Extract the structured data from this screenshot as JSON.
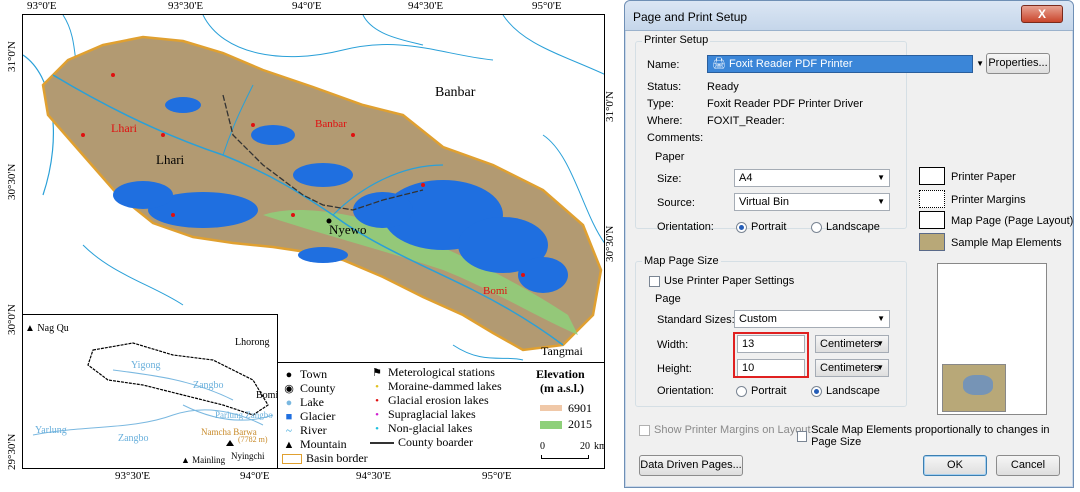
{
  "map": {
    "top_ticks": [
      "93°0'E",
      "93°30'E",
      "94°0'E",
      "94°30'E",
      "95°0'E"
    ],
    "bottom_ticks": [
      "93°30'E",
      "94°0'E",
      "94°30'E",
      "95°0'E"
    ],
    "left_ticks": [
      "31°0'N",
      "30°30'N",
      "30°0'N",
      "29°30'N"
    ],
    "right_ticks": [
      "31°0'N",
      "30°30'N"
    ],
    "labels": {
      "banbar_black": "Banbar",
      "lhari_red": "Lhari",
      "banbar_red": "Banbar",
      "lhari_black": "Lhari",
      "nyewo": "Nyewo",
      "bomi_red": "Bomi",
      "tangmai": "Tangmai"
    },
    "inset": {
      "nag_qu": "Nag Qu",
      "lhorong": "Lhorong",
      "yigong": "Yigong",
      "zangbo_1": "Zangbo",
      "bomi": "Bomi",
      "parlung_zangbo": "Parlung Zangbo",
      "yarlung": "Yarlung",
      "zangbo_2": "Zangbo",
      "namcha_barwa": "Namcha Barwa",
      "peak_height": "(7782 m)",
      "nyingchi": "Nyingchi",
      "mainling": "Mainling"
    },
    "legend": {
      "town": "Town",
      "county": "County",
      "lake": "Lake",
      "glacier": "Glacier",
      "river": "River",
      "mountain": "Mountain",
      "basin_border": "Basin border",
      "met_stations": "Meterological stations",
      "moraine_lakes": "Moraine-dammed lakes",
      "glacial_erosion": "Glacial erosion lakes",
      "supraglacial": "Supraglacial lakes",
      "non_glacial": "Non-glacial lakes",
      "county_border": "County boarder",
      "elevation_title": "Elevation",
      "elevation_unit": "(m a.s.l.)",
      "elev_max": "6901",
      "elev_min": "2015",
      "scale_0": "0",
      "scale_20": "20",
      "scale_unit": "km"
    },
    "colors": {
      "glacier": "#1f6fe0",
      "basin_border": "#e0a030",
      "terrain": "#b29a72",
      "lowland": "#8ed07a",
      "river": "#2aa0d8",
      "red_label": "#e01010"
    }
  },
  "dialog": {
    "title": "Page and Print Setup",
    "close_label": "X",
    "printer_setup": {
      "group_title": "Printer Setup",
      "name_label": "Name:",
      "name_value": "Foxit Reader PDF Printer",
      "properties_label": "Properties...",
      "status_label": "Status:",
      "status_value": "Ready",
      "type_label": "Type:",
      "type_value": "Foxit Reader PDF Printer Driver",
      "where_label": "Where:",
      "where_value": "FOXIT_Reader:",
      "comments_label": "Comments:",
      "paper": {
        "group_title": "Paper",
        "size_label": "Size:",
        "size_value": "A4",
        "source_label": "Source:",
        "source_value": "Virtual Bin",
        "orientation_label": "Orientation:",
        "portrait": "Portrait",
        "landscape": "Landscape",
        "selected": "Portrait"
      }
    },
    "legend_items": {
      "printer_paper": "Printer Paper",
      "printer_margins": "Printer Margins",
      "map_page": "Map Page (Page Layout)",
      "sample_elements": "Sample Map Elements"
    },
    "map_page_size": {
      "group_title": "Map Page Size",
      "use_printer_settings": "Use Printer Paper Settings",
      "use_printer_checked": false,
      "page": {
        "group_title": "Page",
        "standard_sizes_label": "Standard Sizes:",
        "standard_sizes_value": "Custom",
        "width_label": "Width:",
        "width_value": "13",
        "width_unit": "Centimeters",
        "height_label": "Height:",
        "height_value": "10",
        "height_unit": "Centimeters",
        "orientation_label": "Orientation:",
        "portrait": "Portrait",
        "landscape": "Landscape",
        "selected": "Landscape"
      }
    },
    "show_printer_margins": "Show Printer Margins on Layout",
    "scale_elements": "Scale Map Elements proportionally to changes in Page Size",
    "data_driven_pages": "Data Driven Pages...",
    "ok": "OK",
    "cancel": "Cancel"
  }
}
